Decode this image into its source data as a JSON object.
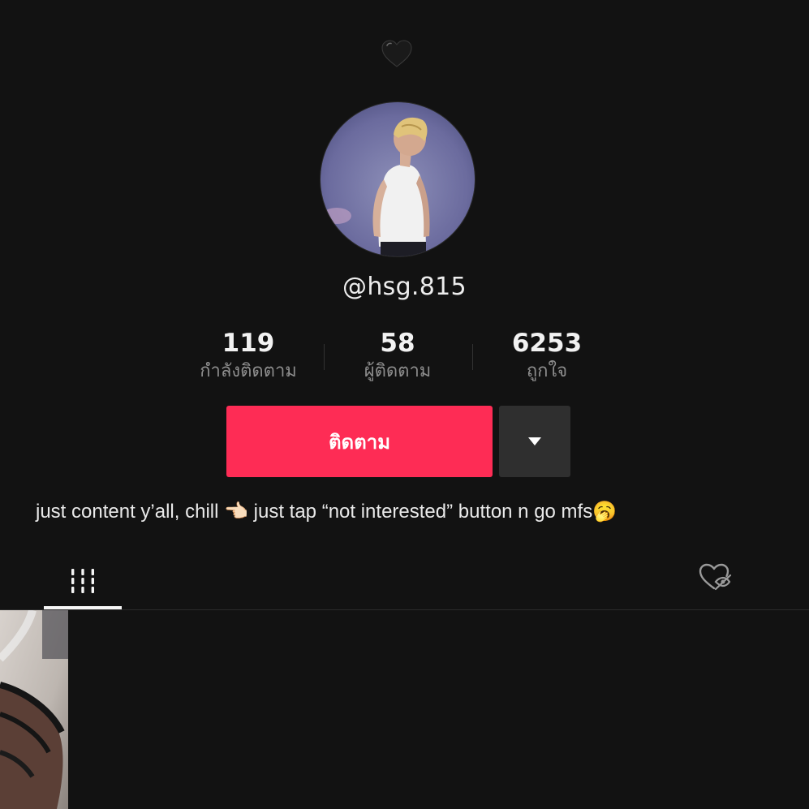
{
  "header": {
    "icon": "black-heart-icon"
  },
  "profile": {
    "username": "@hsg.815",
    "stats": [
      {
        "value": "119",
        "label": "กำลังติดตาม"
      },
      {
        "value": "58",
        "label": "ผู้ติดตาม"
      },
      {
        "value": "6253",
        "label": "ถูกใจ"
      }
    ],
    "follow_label": "ติดตาม",
    "bio": "just content y’all, chill 👈🏻 just tap “not interested” button n go mfs🥱"
  },
  "tabs": {
    "videos_icon": "grid-bars-icon",
    "liked_icon": "heart-hidden-icon"
  },
  "colors": {
    "background": "#121212",
    "accent": "#fe2c55",
    "secondary_button": "#2f2f2f",
    "muted_text": "#8d8d8d"
  }
}
